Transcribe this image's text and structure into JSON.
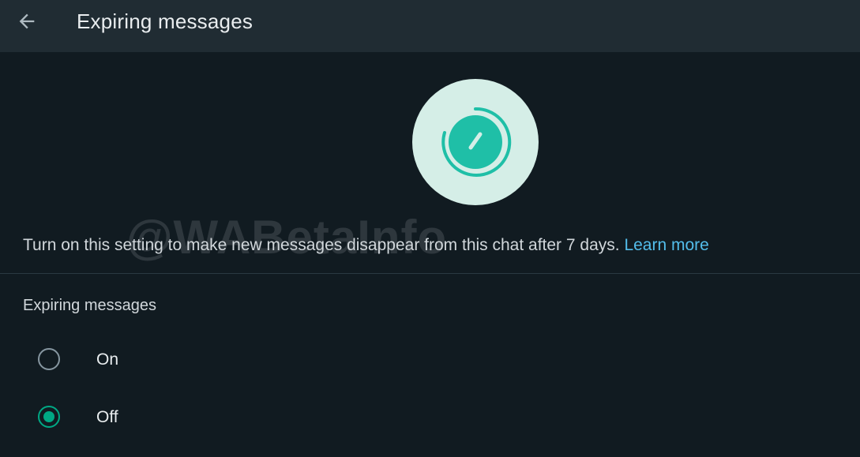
{
  "header": {
    "title": "Expiring messages",
    "back_icon": "arrow-left-icon"
  },
  "hero": {
    "icon": "timer-icon",
    "circle_color": "#d5eee7",
    "accent_color": "#1fbfa7"
  },
  "watermark": "@WABetaInfo",
  "description": {
    "text": "Turn on this setting to make new messages disappear from this chat after 7 days. ",
    "link": "Learn more",
    "link_color": "#53bdeb"
  },
  "section": {
    "title": "Expiring messages",
    "options": [
      {
        "label": "On",
        "selected": false
      },
      {
        "label": "Off",
        "selected": true
      }
    ]
  },
  "colors": {
    "background": "#111b21",
    "appbar": "#202c33",
    "radio_selected": "#00a884",
    "radio_unselected": "#8696a0"
  }
}
